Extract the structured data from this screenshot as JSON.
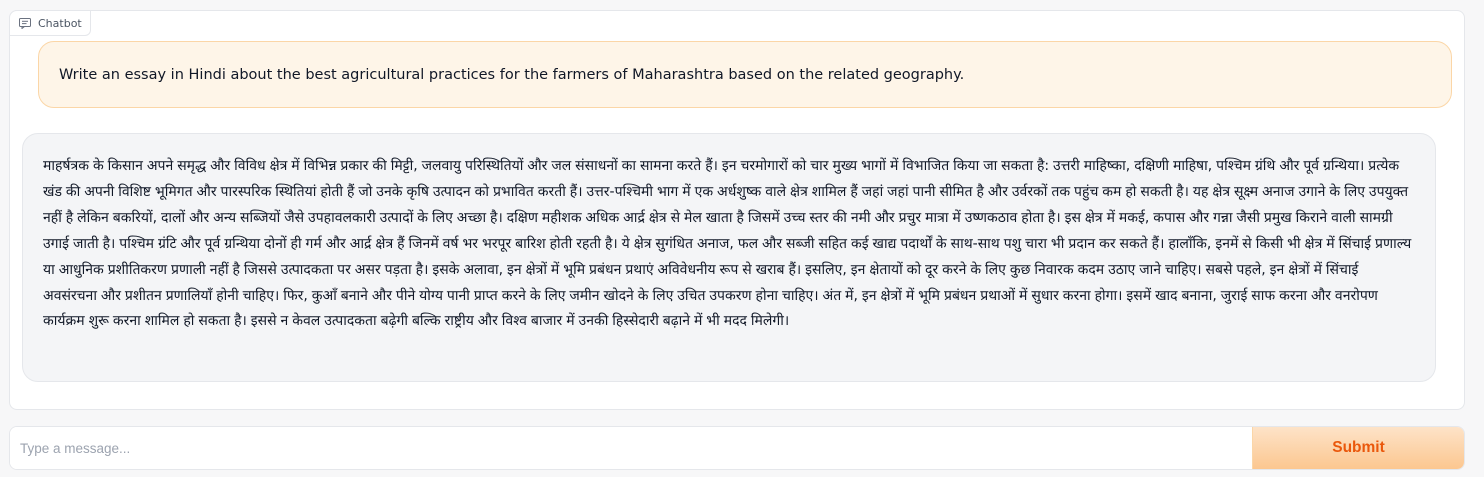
{
  "chatbot": {
    "label": "Chatbot",
    "icon": "chat-bubble-icon"
  },
  "messages": [
    {
      "role": "user",
      "text": "Write an essay in Hindi about the best agricultural practices for the farmers of Maharashtra based on the related geography."
    },
    {
      "role": "bot",
      "text": "माहर्षत्रक के किसान अपने समृद्ध और विविध क्षेत्र में विभिन्न प्रकार की मिट्टी, जलवायु परिस्थितियों और जल संसाधनों का सामना करते हैं। इन चरमोगारों को चार मुख्य भागों में विभाजित किया जा सकता है: उत्तरी माहिष्का, दक्षिणी माहिषा, पश्चिम ग्रंथि और पूर्व ग्रन्थिया। प्रत्येक खंड की अपनी विशिष्ट भूमिगत और पारस्परिक स्थितियां होती हैं जो उनके कृषि उत्पादन को प्रभावित करती हैं। उत्तर-पश्चिमी भाग में एक अर्धशुष्क वाले क्षेत्र शामिल हैं जहां जहां पानी सीमित है और उर्वरकों तक पहुंच कम हो सकती है। यह क्षेत्र सूक्ष्म अनाज उगाने के लिए उपयुक्त नहीं है लेकिन बकरियों, दालों और अन्य सब्जियों जैसे उपहावलकारी उत्पादों के लिए अच्छा है। दक्षिण महीशक अधिक आर्द्र क्षेत्र से मेल खाता है जिसमें उच्च स्तर की नमी और प्रचुर मात्रा में उष्णकठाव होता है। इस क्षेत्र में मकई, कपास और गन्ना जैसी प्रमुख किराने वाली सामग्री उगाई जाती है। पश्चिम ग्रंटि और पूर्व ग्रन्थिया दोनों ही गर्म और आर्द्र क्षेत्र हैं जिनमें वर्ष भर भरपूर बारिश होती रहती है। ये क्षेत्र सुगंधित अनाज, फल और सब्जी सहित कई खाद्य पदार्थों के साथ-साथ पशु चारा भी प्रदान कर सकते हैं। हालाँकि, इनमें से किसी भी क्षेत्र में सिंचाई प्रणाल्य या आधुनिक प्रशीतिकरण प्रणाली नहीं है जिससे उत्पादकता पर असर पड़ता है। इसके अलावा, इन क्षेत्रों में भूमि प्रबंधन प्रथाएं अविवेधनीय रूप से खराब हैं। इसलिए, इन क्षेतायों को दूर करने के लिए कुछ निवारक कदम उठाए जाने चाहिए। सबसे पहले, इन क्षेत्रों में सिंचाई अवसंरचना और प्रशीतन प्रणालियाँ होनी चाहिए। फिर, कुआँ बनाने और पीने योग्य पानी प्राप्त करने के लिए जमीन खोदने के लिए उचित उपकरण होना चाहिए। अंत में, इन क्षेत्रों में भूमि प्रबंधन प्रथाओं में सुधार करना होगा। इसमें खाद बनाना, जुराई साफ करना और वनरोपण कार्यक्रम शुरू करना शामिल हो सकता है। इससे न केवल उत्पादकता बढ़ेगी बल्कि राष्ट्रीय और विश्व बाजार में उनकी हिस्सेदारी बढ़ाने में भी मदद मिलेगी।"
    }
  ],
  "input": {
    "placeholder": "Type a message...",
    "value": ""
  },
  "submit": {
    "label": "Submit"
  },
  "colors": {
    "accent": "#ea580c",
    "user_bubble": "#fef5e8",
    "bot_bubble": "#f4f5f7"
  }
}
